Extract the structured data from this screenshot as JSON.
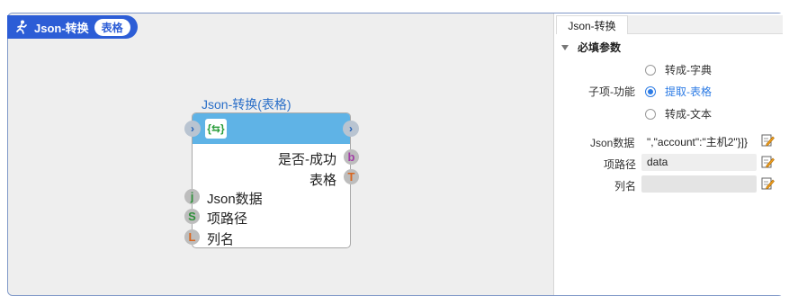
{
  "header": {
    "title": "Json-转换",
    "badge": "表格"
  },
  "node": {
    "title": "Json-转换(表格)",
    "outputs": [
      {
        "label": "是否-成功",
        "port": "b",
        "color": "#a23ea6"
      },
      {
        "label": "表格",
        "port": "T",
        "color": "#d9661f"
      }
    ],
    "inputs": [
      {
        "label": "Json数据",
        "port": "j",
        "color": "#2f8f3a"
      },
      {
        "label": "项路径",
        "port": "S",
        "color": "#2f8f3a"
      },
      {
        "label": "列名",
        "port": "L",
        "color": "#d9661f"
      }
    ]
  },
  "panel": {
    "tab": "Json-转换",
    "section": "必填参数",
    "sub_function_label": "子项-功能",
    "options": [
      "转成-字典",
      "提取-表格",
      "转成-文本"
    ],
    "selected_option": "提取-表格",
    "fields": [
      {
        "label": "Json数据",
        "value": "\",\"account\":\"主机2\"}]}"
      },
      {
        "label": "项路径",
        "value": "data"
      },
      {
        "label": "列名",
        "value": ""
      }
    ]
  }
}
